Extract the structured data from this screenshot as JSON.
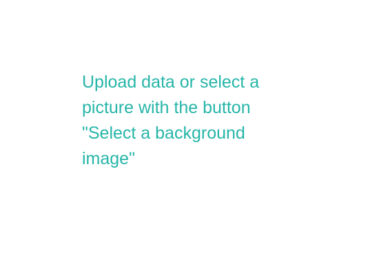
{
  "empty_state": {
    "message": "Upload data or select a picture with the button \"Select a background image\""
  },
  "colors": {
    "accent_text": "#26b5a8",
    "background": "#ffffff"
  }
}
